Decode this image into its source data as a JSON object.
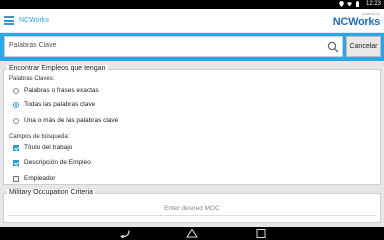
{
  "status_bar": {
    "time": "12:23"
  },
  "app_bar": {
    "title": "NCWorks",
    "logo_powered": "powered by",
    "logo_brand": "NCWorks"
  },
  "search": {
    "placeholder": "Palabras Clave",
    "cancel_label": "Cancelar"
  },
  "section1": {
    "legend": "Encontrar Empleos que tengan",
    "keywords_label": "Palabras Claves:",
    "keyword_options": [
      {
        "label": "Palabras o frases exactas",
        "selected": false
      },
      {
        "label": "Todas las palabras clave",
        "selected": true
      },
      {
        "label": "Una o más de las palabras clave",
        "selected": false
      }
    ],
    "fields_label": "Campos de búsqueda:",
    "field_options": [
      {
        "label": "Título del trabajo",
        "checked": true
      },
      {
        "label": "Descripción de Empleo",
        "checked": true
      },
      {
        "label": "Empleador",
        "checked": false
      }
    ]
  },
  "section2": {
    "legend": "Military Occupation Criteria",
    "moc_placeholder": "Enter desired MOC"
  },
  "colors": {
    "accent": "#2aa7e6",
    "brand": "#1f6fb6"
  }
}
